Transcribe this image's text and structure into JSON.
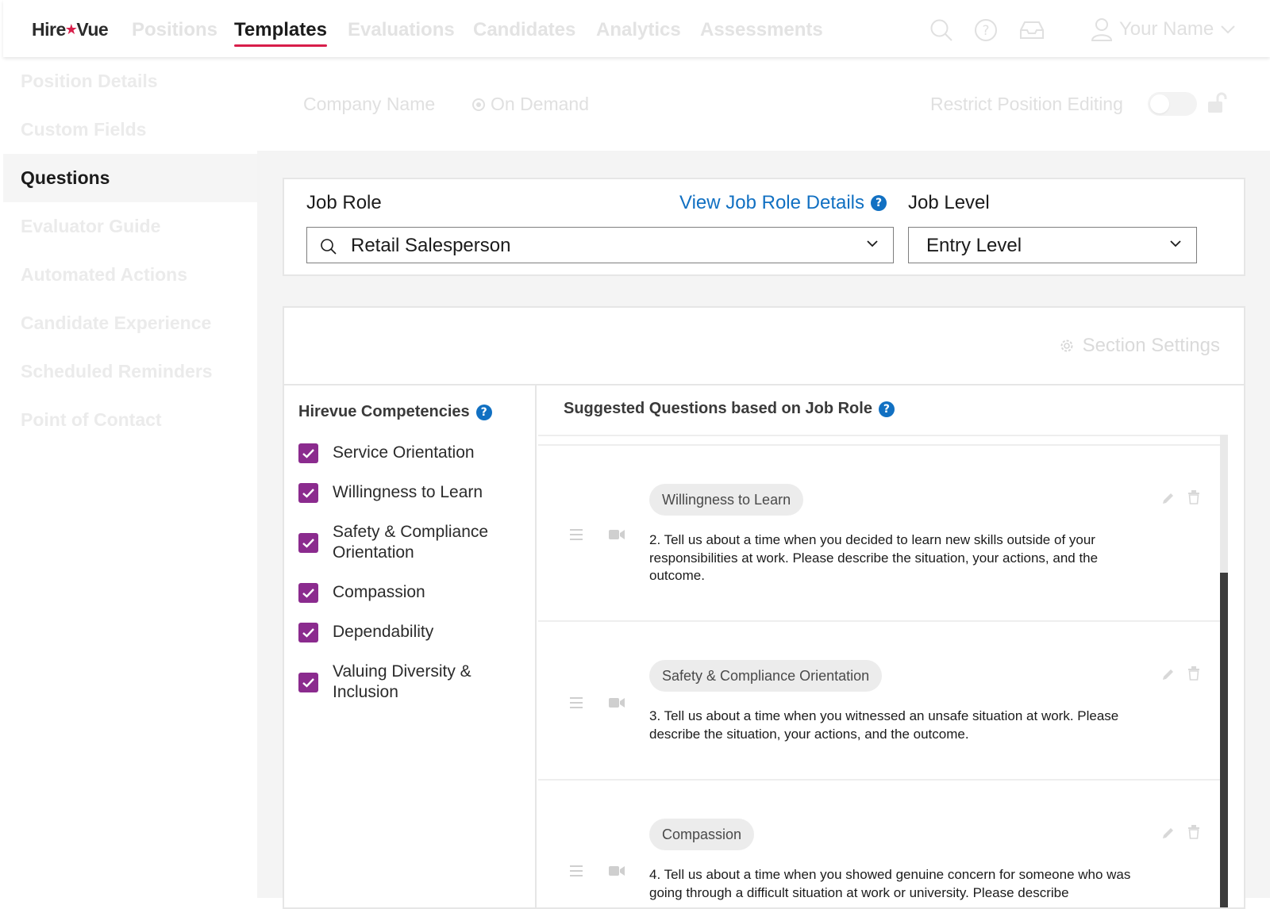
{
  "brand": {
    "logo_left": "Hire",
    "logo_star": "★",
    "logo_right": "Vue",
    "accent": "#d81e4a",
    "link_color": "#1170c2",
    "checkbox_color": "#8b2b8e"
  },
  "nav": {
    "tabs": [
      {
        "label": "Positions"
      },
      {
        "label": "Templates",
        "active": true
      },
      {
        "label": "Evaluations"
      },
      {
        "label": "Candidates"
      },
      {
        "label": "Analytics"
      },
      {
        "label": "Assessments"
      }
    ],
    "icons": [
      "search-icon",
      "help-icon",
      "inbox-icon",
      "user-icon"
    ],
    "user_name": "Your Name"
  },
  "sidebar": {
    "items": [
      {
        "label": "Position Details"
      },
      {
        "label": "Custom Fields"
      },
      {
        "label": "Questions",
        "active": true
      },
      {
        "label": "Evaluator Guide"
      },
      {
        "label": "Automated Actions"
      },
      {
        "label": "Candidate Experience"
      },
      {
        "label": "Scheduled Reminders"
      },
      {
        "label": "Point of Contact"
      }
    ]
  },
  "info": {
    "company_name": "Company Name",
    "mode": "On Demand",
    "restrict_label": "Restrict Position Editing",
    "restrict_enabled": false
  },
  "job": {
    "role_label": "Job Role",
    "view_details_link": "View Job Role Details",
    "role_value": "Retail Salesperson",
    "level_label": "Job Level",
    "level_value": "Entry Level"
  },
  "questions_section": {
    "settings_label": "Section Settings",
    "competencies_title": "Hirevue Competencies",
    "competencies": [
      {
        "label": "Service Orientation",
        "checked": true
      },
      {
        "label": "Willingness to Learn",
        "checked": true
      },
      {
        "label": "Safety & Compliance Orientation",
        "checked": true
      },
      {
        "label": "Compassion",
        "checked": true
      },
      {
        "label": "Dependability",
        "checked": true
      },
      {
        "label": "Valuing Diversity & Inclusion",
        "checked": true
      }
    ],
    "suggested_title": "Suggested Questions based on Job Role",
    "questions": [
      {
        "tag": "Willingness to Learn",
        "text": "2. Tell us about a time when you decided to learn new skills outside of your responsibilities at work. Please describe the situation, your actions, and the outcome."
      },
      {
        "tag": "Safety & Compliance Orientation",
        "text": "3. Tell us about a time when you witnessed an unsafe situation at work. Please describe the situation, your actions, and the outcome."
      },
      {
        "tag": "Compassion",
        "text": "4. Tell us about a time when you showed genuine concern for someone who was going through a difficult situation at work or university. Please describe"
      }
    ]
  }
}
